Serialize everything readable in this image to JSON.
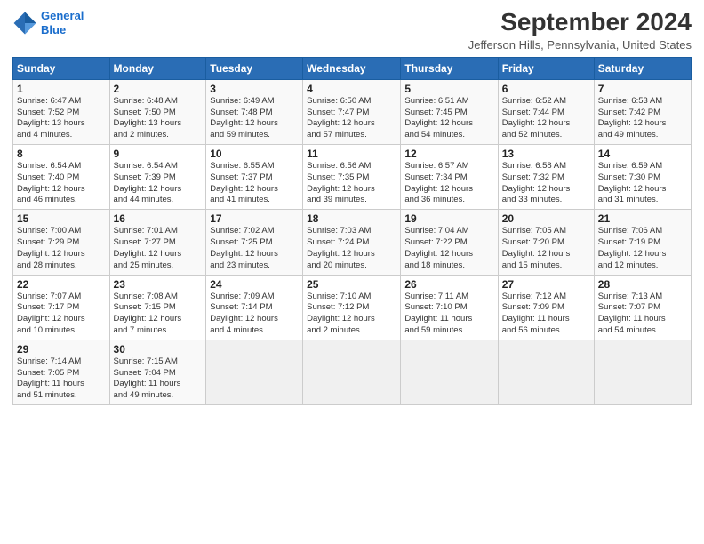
{
  "header": {
    "logo_line1": "General",
    "logo_line2": "Blue",
    "month": "September 2024",
    "location": "Jefferson Hills, Pennsylvania, United States"
  },
  "weekdays": [
    "Sunday",
    "Monday",
    "Tuesday",
    "Wednesday",
    "Thursday",
    "Friday",
    "Saturday"
  ],
  "weeks": [
    [
      {
        "day": "1",
        "info": "Sunrise: 6:47 AM\nSunset: 7:52 PM\nDaylight: 13 hours\nand 4 minutes."
      },
      {
        "day": "2",
        "info": "Sunrise: 6:48 AM\nSunset: 7:50 PM\nDaylight: 13 hours\nand 2 minutes."
      },
      {
        "day": "3",
        "info": "Sunrise: 6:49 AM\nSunset: 7:48 PM\nDaylight: 12 hours\nand 59 minutes."
      },
      {
        "day": "4",
        "info": "Sunrise: 6:50 AM\nSunset: 7:47 PM\nDaylight: 12 hours\nand 57 minutes."
      },
      {
        "day": "5",
        "info": "Sunrise: 6:51 AM\nSunset: 7:45 PM\nDaylight: 12 hours\nand 54 minutes."
      },
      {
        "day": "6",
        "info": "Sunrise: 6:52 AM\nSunset: 7:44 PM\nDaylight: 12 hours\nand 52 minutes."
      },
      {
        "day": "7",
        "info": "Sunrise: 6:53 AM\nSunset: 7:42 PM\nDaylight: 12 hours\nand 49 minutes."
      }
    ],
    [
      {
        "day": "8",
        "info": "Sunrise: 6:54 AM\nSunset: 7:40 PM\nDaylight: 12 hours\nand 46 minutes."
      },
      {
        "day": "9",
        "info": "Sunrise: 6:54 AM\nSunset: 7:39 PM\nDaylight: 12 hours\nand 44 minutes."
      },
      {
        "day": "10",
        "info": "Sunrise: 6:55 AM\nSunset: 7:37 PM\nDaylight: 12 hours\nand 41 minutes."
      },
      {
        "day": "11",
        "info": "Sunrise: 6:56 AM\nSunset: 7:35 PM\nDaylight: 12 hours\nand 39 minutes."
      },
      {
        "day": "12",
        "info": "Sunrise: 6:57 AM\nSunset: 7:34 PM\nDaylight: 12 hours\nand 36 minutes."
      },
      {
        "day": "13",
        "info": "Sunrise: 6:58 AM\nSunset: 7:32 PM\nDaylight: 12 hours\nand 33 minutes."
      },
      {
        "day": "14",
        "info": "Sunrise: 6:59 AM\nSunset: 7:30 PM\nDaylight: 12 hours\nand 31 minutes."
      }
    ],
    [
      {
        "day": "15",
        "info": "Sunrise: 7:00 AM\nSunset: 7:29 PM\nDaylight: 12 hours\nand 28 minutes."
      },
      {
        "day": "16",
        "info": "Sunrise: 7:01 AM\nSunset: 7:27 PM\nDaylight: 12 hours\nand 25 minutes."
      },
      {
        "day": "17",
        "info": "Sunrise: 7:02 AM\nSunset: 7:25 PM\nDaylight: 12 hours\nand 23 minutes."
      },
      {
        "day": "18",
        "info": "Sunrise: 7:03 AM\nSunset: 7:24 PM\nDaylight: 12 hours\nand 20 minutes."
      },
      {
        "day": "19",
        "info": "Sunrise: 7:04 AM\nSunset: 7:22 PM\nDaylight: 12 hours\nand 18 minutes."
      },
      {
        "day": "20",
        "info": "Sunrise: 7:05 AM\nSunset: 7:20 PM\nDaylight: 12 hours\nand 15 minutes."
      },
      {
        "day": "21",
        "info": "Sunrise: 7:06 AM\nSunset: 7:19 PM\nDaylight: 12 hours\nand 12 minutes."
      }
    ],
    [
      {
        "day": "22",
        "info": "Sunrise: 7:07 AM\nSunset: 7:17 PM\nDaylight: 12 hours\nand 10 minutes."
      },
      {
        "day": "23",
        "info": "Sunrise: 7:08 AM\nSunset: 7:15 PM\nDaylight: 12 hours\nand 7 minutes."
      },
      {
        "day": "24",
        "info": "Sunrise: 7:09 AM\nSunset: 7:14 PM\nDaylight: 12 hours\nand 4 minutes."
      },
      {
        "day": "25",
        "info": "Sunrise: 7:10 AM\nSunset: 7:12 PM\nDaylight: 12 hours\nand 2 minutes."
      },
      {
        "day": "26",
        "info": "Sunrise: 7:11 AM\nSunset: 7:10 PM\nDaylight: 11 hours\nand 59 minutes."
      },
      {
        "day": "27",
        "info": "Sunrise: 7:12 AM\nSunset: 7:09 PM\nDaylight: 11 hours\nand 56 minutes."
      },
      {
        "day": "28",
        "info": "Sunrise: 7:13 AM\nSunset: 7:07 PM\nDaylight: 11 hours\nand 54 minutes."
      }
    ],
    [
      {
        "day": "29",
        "info": "Sunrise: 7:14 AM\nSunset: 7:05 PM\nDaylight: 11 hours\nand 51 minutes."
      },
      {
        "day": "30",
        "info": "Sunrise: 7:15 AM\nSunset: 7:04 PM\nDaylight: 11 hours\nand 49 minutes."
      },
      {
        "day": "",
        "info": ""
      },
      {
        "day": "",
        "info": ""
      },
      {
        "day": "",
        "info": ""
      },
      {
        "day": "",
        "info": ""
      },
      {
        "day": "",
        "info": ""
      }
    ]
  ]
}
